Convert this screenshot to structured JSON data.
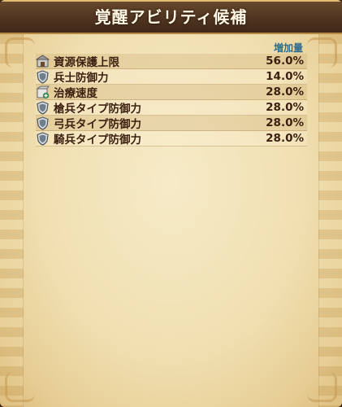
{
  "header": {
    "title": "覚醒アビリティ候補"
  },
  "list": {
    "column_header": "増加量",
    "rows": [
      {
        "label": "資源保護上限",
        "value": "56.0%",
        "icon": "warehouse-icon"
      },
      {
        "label": "兵士防御力",
        "value": "14.0%",
        "icon": "shield-icon"
      },
      {
        "label": "治療速度",
        "value": "28.0%",
        "icon": "healing-box-icon"
      },
      {
        "label": "槍兵タイプ防御力",
        "value": "28.0%",
        "icon": "shield-icon"
      },
      {
        "label": "弓兵タイプ防御力",
        "value": "28.0%",
        "icon": "shield-icon"
      },
      {
        "label": "騎兵タイプ防御力",
        "value": "28.0%",
        "icon": "shield-icon"
      }
    ]
  }
}
